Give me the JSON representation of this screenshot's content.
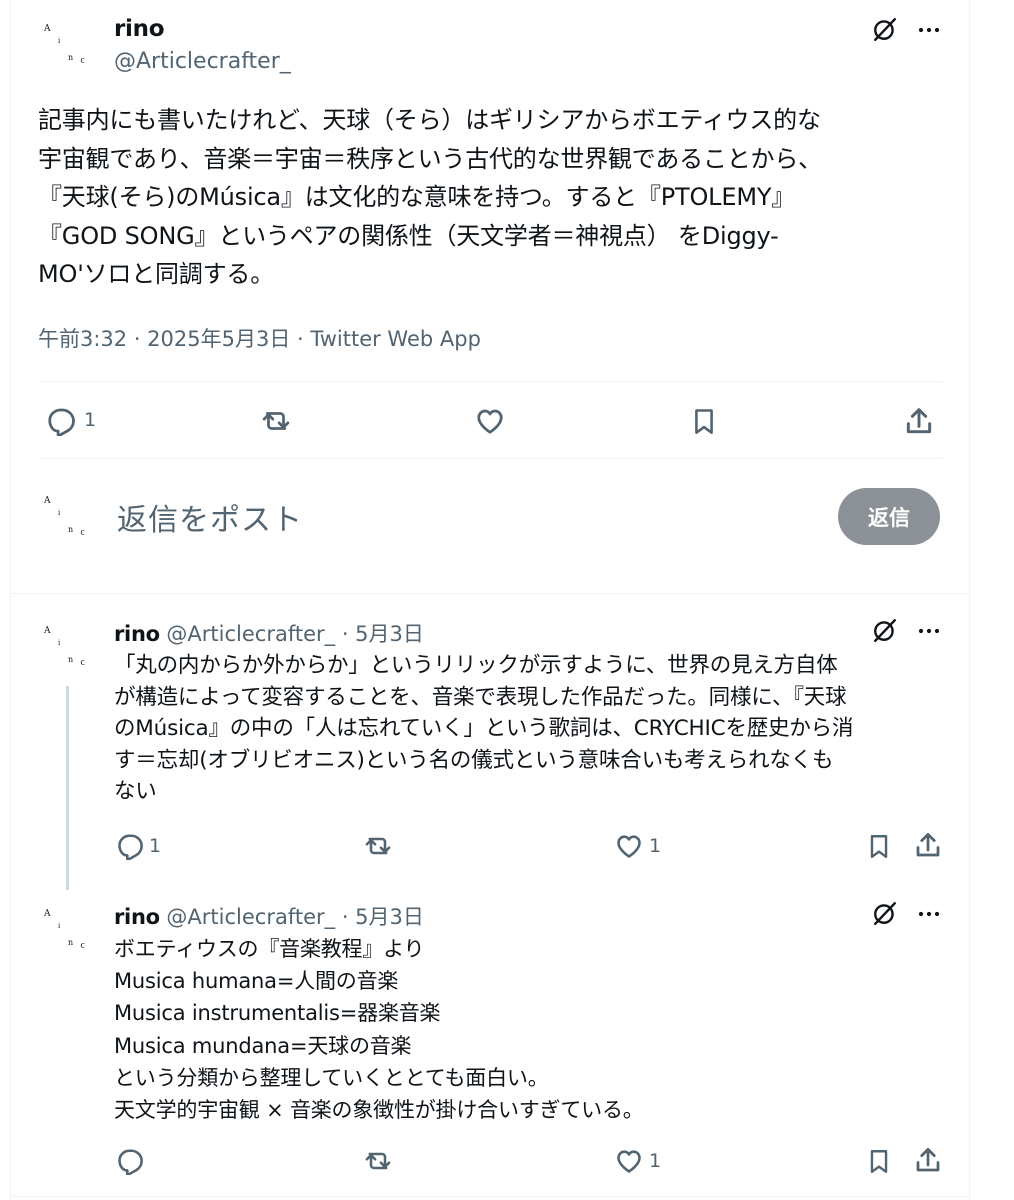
{
  "main_post": {
    "name": "rino",
    "handle": "@Articlecrafter_",
    "text": "記事内にも書いたけれど、天球（そら）はギリシアからボエティウス的な\n宇宙観であり、音楽＝宇宙＝秩序という古代的な世界観であることから、\n『天球(そら)のMúsica』は文化的な意味を持つ。すると『PTOLEMY』\n『GOD SONG』というペアの関係性（天文学者＝神視点） をDiggy-\nMO'ソロと同調する。",
    "meta": "午前3:32 · 2025年5月3日 · Twitter Web App",
    "reply_count": "1"
  },
  "composer": {
    "placeholder": "返信をポスト",
    "button_label": "返信"
  },
  "replies": [
    {
      "name": "rino",
      "handle_date": "@Articlecrafter_ · 5月3日",
      "text": "「丸の内からか外からか」というリリックが示すように、世界の見え方自体\nが構造によって変容することを、音楽で表現した作品だった。同様に、『天球\nのMúsica』の中の「人は忘れていく」という歌詞は、CRYCHICを歴史から消\nす＝忘却(オブリビオニス)という名の儀式という意味合いも考えられなくも\nない",
      "reply_count": "1",
      "like_count": "1"
    },
    {
      "name": "rino",
      "handle_date": "@Articlecrafter_ · 5月3日",
      "text": "ボエティウスの『音楽教程』より\nMusica humana=人間の音楽\nMusica instrumentalis=器楽音楽\nMusica mundana=天球の音楽\nという分類から整理していくととても面白い。\n天文学的宇宙観 × 音楽の象徴性が掛け合いすぎている。",
      "reply_count": "",
      "like_count": "1"
    }
  ],
  "avatar": {
    "glyphs": [
      "A",
      "i",
      "n",
      "ᑦ"
    ]
  },
  "icons": {
    "grok": "grok-icon",
    "more": "more-icon",
    "reply": "reply-icon",
    "repost": "repost-icon",
    "like": "like-icon",
    "bookmark": "bookmark-icon",
    "share": "share-icon"
  },
  "colors": {
    "text": "#0f1419",
    "muted": "#536471",
    "divider": "#eff3f4",
    "thread_line": "#cfd9de",
    "reply_button": "#8b9196"
  }
}
